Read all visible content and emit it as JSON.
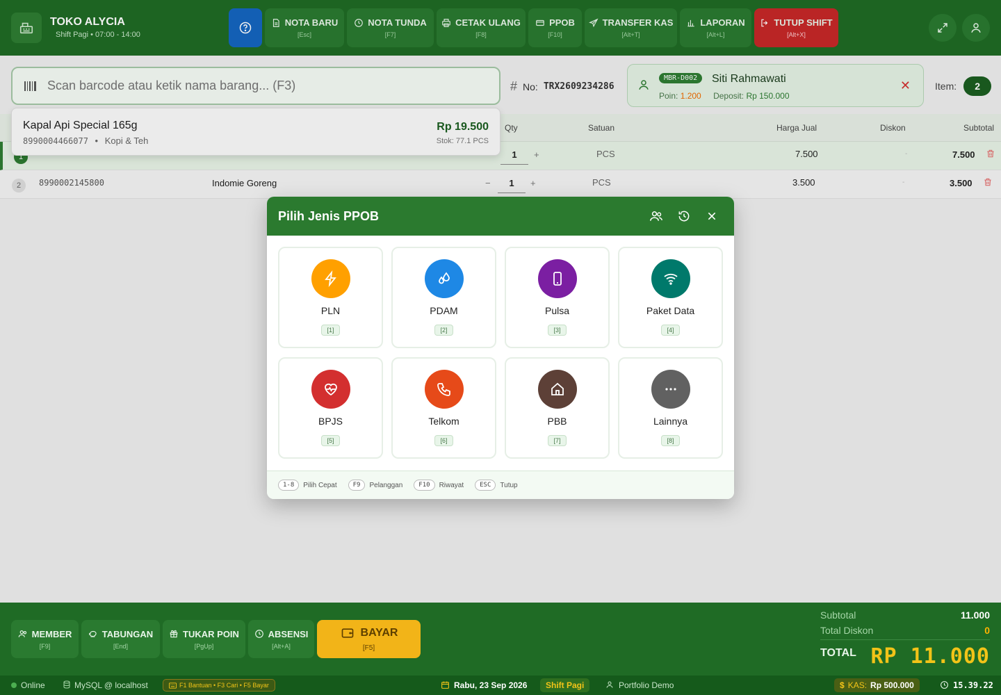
{
  "header": {
    "store_name": "TOKO ALYCIA",
    "shift_info": "Shift Pagi • 07:00 - 14:00",
    "buttons": [
      {
        "label": "NOTA BARU",
        "key": "[Esc]"
      },
      {
        "label": "NOTA TUNDA",
        "key": "[F7]"
      },
      {
        "label": "CETAK ULANG",
        "key": "[F8]"
      },
      {
        "label": "PPOB",
        "key": "[F10]"
      },
      {
        "label": "TRANSFER KAS",
        "key": "[Alt+T]"
      },
      {
        "label": "LAPORAN",
        "key": "[Alt+L]"
      },
      {
        "label": "TUTUP SHIFT",
        "key": "[Alt+X]"
      }
    ],
    "colors": {
      "header_bg": "#1f6b25",
      "help_btn": "#1565c0",
      "close_shift": "#c62828"
    }
  },
  "search": {
    "placeholder": "Scan barcode atau ketik nama barang... (F3)"
  },
  "transaction": {
    "no_label": "No:",
    "number": "TRX2609234286"
  },
  "member": {
    "code": "MBR-D002",
    "name": "Siti Rahmawati",
    "poin_label": "Poin:",
    "poin": "1.200",
    "deposit_label": "Deposit:",
    "deposit": "Rp 150.000"
  },
  "item_count": {
    "label": "Item:",
    "value": "2"
  },
  "table": {
    "headers": [
      "Qty",
      "Satuan",
      "Harga Jual",
      "Diskon",
      "Subtotal"
    ],
    "rows": [
      {
        "no": "1",
        "barcode": "",
        "name": "",
        "qty": "1",
        "unit": "PCS",
        "price": "7.500",
        "discount": "-",
        "subtotal": "7.500"
      },
      {
        "no": "2",
        "barcode": "8990002145800",
        "name": "Indomie Goreng",
        "qty": "1",
        "unit": "PCS",
        "price": "3.500",
        "discount": "-",
        "subtotal": "3.500"
      }
    ]
  },
  "dropdown": {
    "name": "Kapal Api Special 165g",
    "barcode": "8990004466077",
    "separator": "•",
    "category": "Kopi & Teh",
    "price": "Rp 19.500",
    "stock": "Stok: 77.1 PCS"
  },
  "modal": {
    "title": "Pilih Jenis PPOB",
    "items": [
      {
        "label": "PLN",
        "key": "[1]",
        "icon": "lightning-icon",
        "color": "#ffa000"
      },
      {
        "label": "PDAM",
        "key": "[2]",
        "icon": "water-drop-icon",
        "color": "#1e88e5"
      },
      {
        "label": "Pulsa",
        "key": "[3]",
        "icon": "smartphone-icon",
        "color": "#7b1fa2"
      },
      {
        "label": "Paket Data",
        "key": "[4]",
        "icon": "wifi-icon",
        "color": "#00796b"
      },
      {
        "label": "BPJS",
        "key": "[5]",
        "icon": "heart-pulse-icon",
        "color": "#d32f2f"
      },
      {
        "label": "Telkom",
        "key": "[6]",
        "icon": "phone-icon",
        "color": "#e64a19"
      },
      {
        "label": "PBB",
        "key": "[7]",
        "icon": "home-icon",
        "color": "#5d4037"
      },
      {
        "label": "Lainnya",
        "key": "[8]",
        "icon": "more-dots-icon",
        "color": "#616161"
      }
    ],
    "footer": [
      {
        "key": "1-8",
        "text": "Pilih Cepat"
      },
      {
        "key": "F9",
        "text": "Pelanggan"
      },
      {
        "key": "F10",
        "text": "Riwayat"
      },
      {
        "key": "ESC",
        "text": "Tutup"
      }
    ]
  },
  "bottom": {
    "buttons": [
      {
        "label": "MEMBER",
        "key": "[F9]"
      },
      {
        "label": "TABUNGAN",
        "key": "[End]"
      },
      {
        "label": "TUKAR POIN",
        "key": "[PgUp]"
      },
      {
        "label": "ABSENSI",
        "key": "[Alt+A]"
      }
    ],
    "pay": {
      "label": "BAYAR",
      "key": "[F5]"
    },
    "subtotal_label": "Subtotal",
    "subtotal": "11.000",
    "discount_label": "Total Diskon",
    "discount": "0",
    "total_label": "TOTAL",
    "total": "RP 11.000"
  },
  "status": {
    "online": "Online",
    "db": "MySQL @ localhost",
    "shortcuts": "F1 Bantuan • F3 Cari • F5 Bayar",
    "date": "Rabu, 23 Sep 2026",
    "shift": "Shift Pagi",
    "user": "Portfolio Demo",
    "kas_label": "KAS:",
    "kas": "Rp 500.000",
    "time": "15.39.22"
  }
}
